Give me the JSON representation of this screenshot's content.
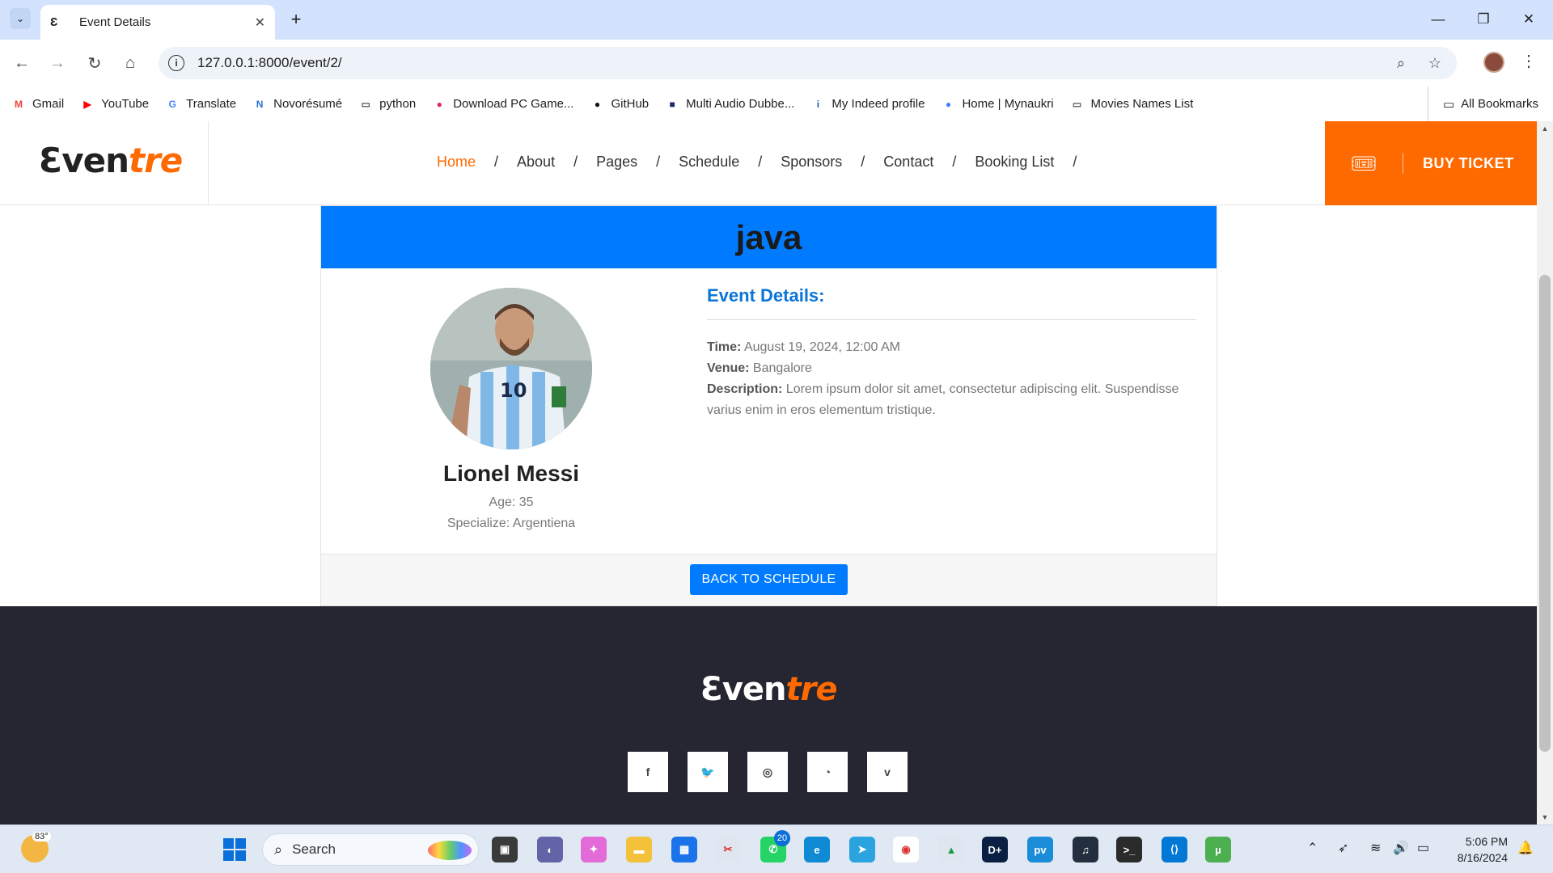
{
  "browser": {
    "tab_title": "Event Details",
    "tab_favicon": "Ɛ",
    "url": "127.0.0.1:8000/event/2/",
    "bookmarks": [
      {
        "label": "Gmail",
        "icon": "gmail-icon"
      },
      {
        "label": "YouTube",
        "icon": "youtube-icon"
      },
      {
        "label": "Translate",
        "icon": "translate-icon"
      },
      {
        "label": "Novorésumé",
        "icon": "novoresume-icon"
      },
      {
        "label": "python",
        "icon": "folder-icon"
      },
      {
        "label": "Download PC Game...",
        "icon": "game-icon"
      },
      {
        "label": "GitHub",
        "icon": "github-icon"
      },
      {
        "label": "Multi Audio Dubbe...",
        "icon": "film-icon"
      },
      {
        "label": "My Indeed profile",
        "icon": "indeed-icon"
      },
      {
        "label": "Home | Mynaukri",
        "icon": "naukri-icon"
      },
      {
        "label": "Movies Names List",
        "icon": "folder-icon"
      }
    ],
    "all_bookmarks": "All Bookmarks"
  },
  "site": {
    "logo_a": "Ɛven",
    "logo_b": "tre",
    "nav": [
      {
        "label": "Home",
        "active": true
      },
      {
        "label": "About"
      },
      {
        "label": "Pages"
      },
      {
        "label": "Schedule"
      },
      {
        "label": "Sponsors"
      },
      {
        "label": "Contact"
      },
      {
        "label": "Booking List"
      }
    ],
    "nav_separator": "/",
    "buy_ticket": "BUY TICKET",
    "accent": "#ff6a00"
  },
  "event": {
    "name": "java",
    "speaker_name": "Lionel Messi",
    "speaker_age": "Age: 35",
    "speaker_specialize": "Specialize: Argentiena",
    "details_title": "Event Details:",
    "time_label": "Time:",
    "time_value": "August 19, 2024, 12:00 AM",
    "venue_label": "Venue:",
    "venue_value": "Bangalore",
    "description_label": "Description:",
    "description_value": "Lorem ipsum dolor sit amet, consectetur adipiscing elit. Suspendisse varius enim in eros elementum tristique.",
    "back_button": "BACK TO SCHEDULE",
    "header_color": "#007bff"
  },
  "footer": {
    "logo_a": "Ɛven",
    "logo_b": "tre",
    "socials": [
      {
        "name": "facebook-icon",
        "glyph": "f"
      },
      {
        "name": "twitter-icon",
        "glyph": "🐦"
      },
      {
        "name": "instagram-icon",
        "glyph": "◎"
      },
      {
        "name": "rss-icon",
        "glyph": "◔"
      },
      {
        "name": "vimeo-icon",
        "glyph": "v"
      }
    ],
    "background": "#252631"
  },
  "taskbar": {
    "temperature": "83°",
    "search_placeholder": "Search",
    "whatsapp_badge": "20",
    "time": "5:06 PM",
    "date": "8/16/2024"
  }
}
